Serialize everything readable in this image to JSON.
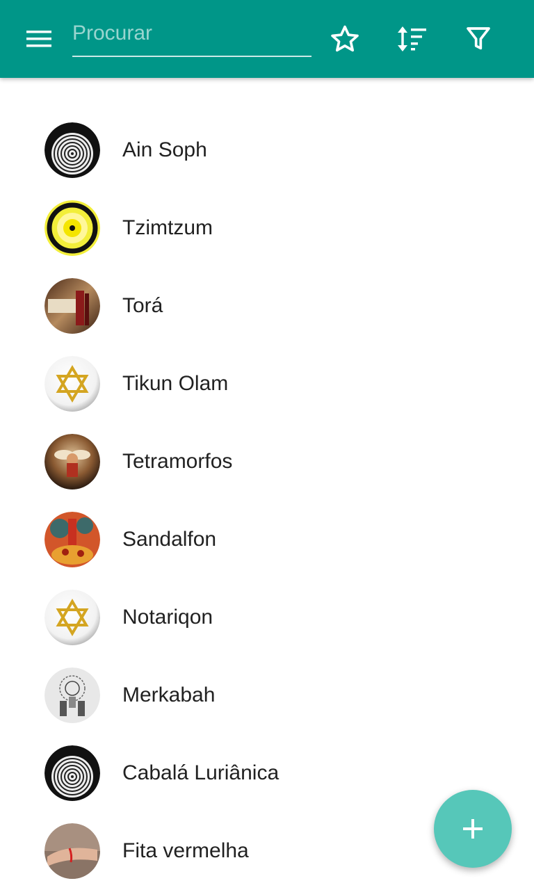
{
  "toolbar": {
    "menu_icon": "menu-icon",
    "search_placeholder": "Procurar",
    "search_value": "",
    "favorite_icon": "star-outline-icon",
    "sort_icon": "sort-icon",
    "filter_icon": "filter-icon"
  },
  "items": [
    {
      "label": "Ain Soph",
      "image": "spiral-seal-image"
    },
    {
      "label": "Tzimtzum",
      "image": "yellow-circle-image"
    },
    {
      "label": "Torá",
      "image": "torah-scroll-image"
    },
    {
      "label": "Tikun Olam",
      "image": "star-of-david-image"
    },
    {
      "label": "Tetramorfos",
      "image": "angel-painting-image"
    },
    {
      "label": "Sandalfon",
      "image": "angel-fire-painting-image"
    },
    {
      "label": "Notariqon",
      "image": "star-of-david-image"
    },
    {
      "label": "Merkabah",
      "image": "engraving-image"
    },
    {
      "label": "Cabalá Luriânica",
      "image": "spiral-seal-image"
    },
    {
      "label": "Fita vermelha",
      "image": "red-string-wrist-image"
    }
  ],
  "fab": {
    "icon": "plus-icon"
  },
  "colors": {
    "appbar": "#009688",
    "fab": "#56c7b9",
    "text": "#212121"
  }
}
